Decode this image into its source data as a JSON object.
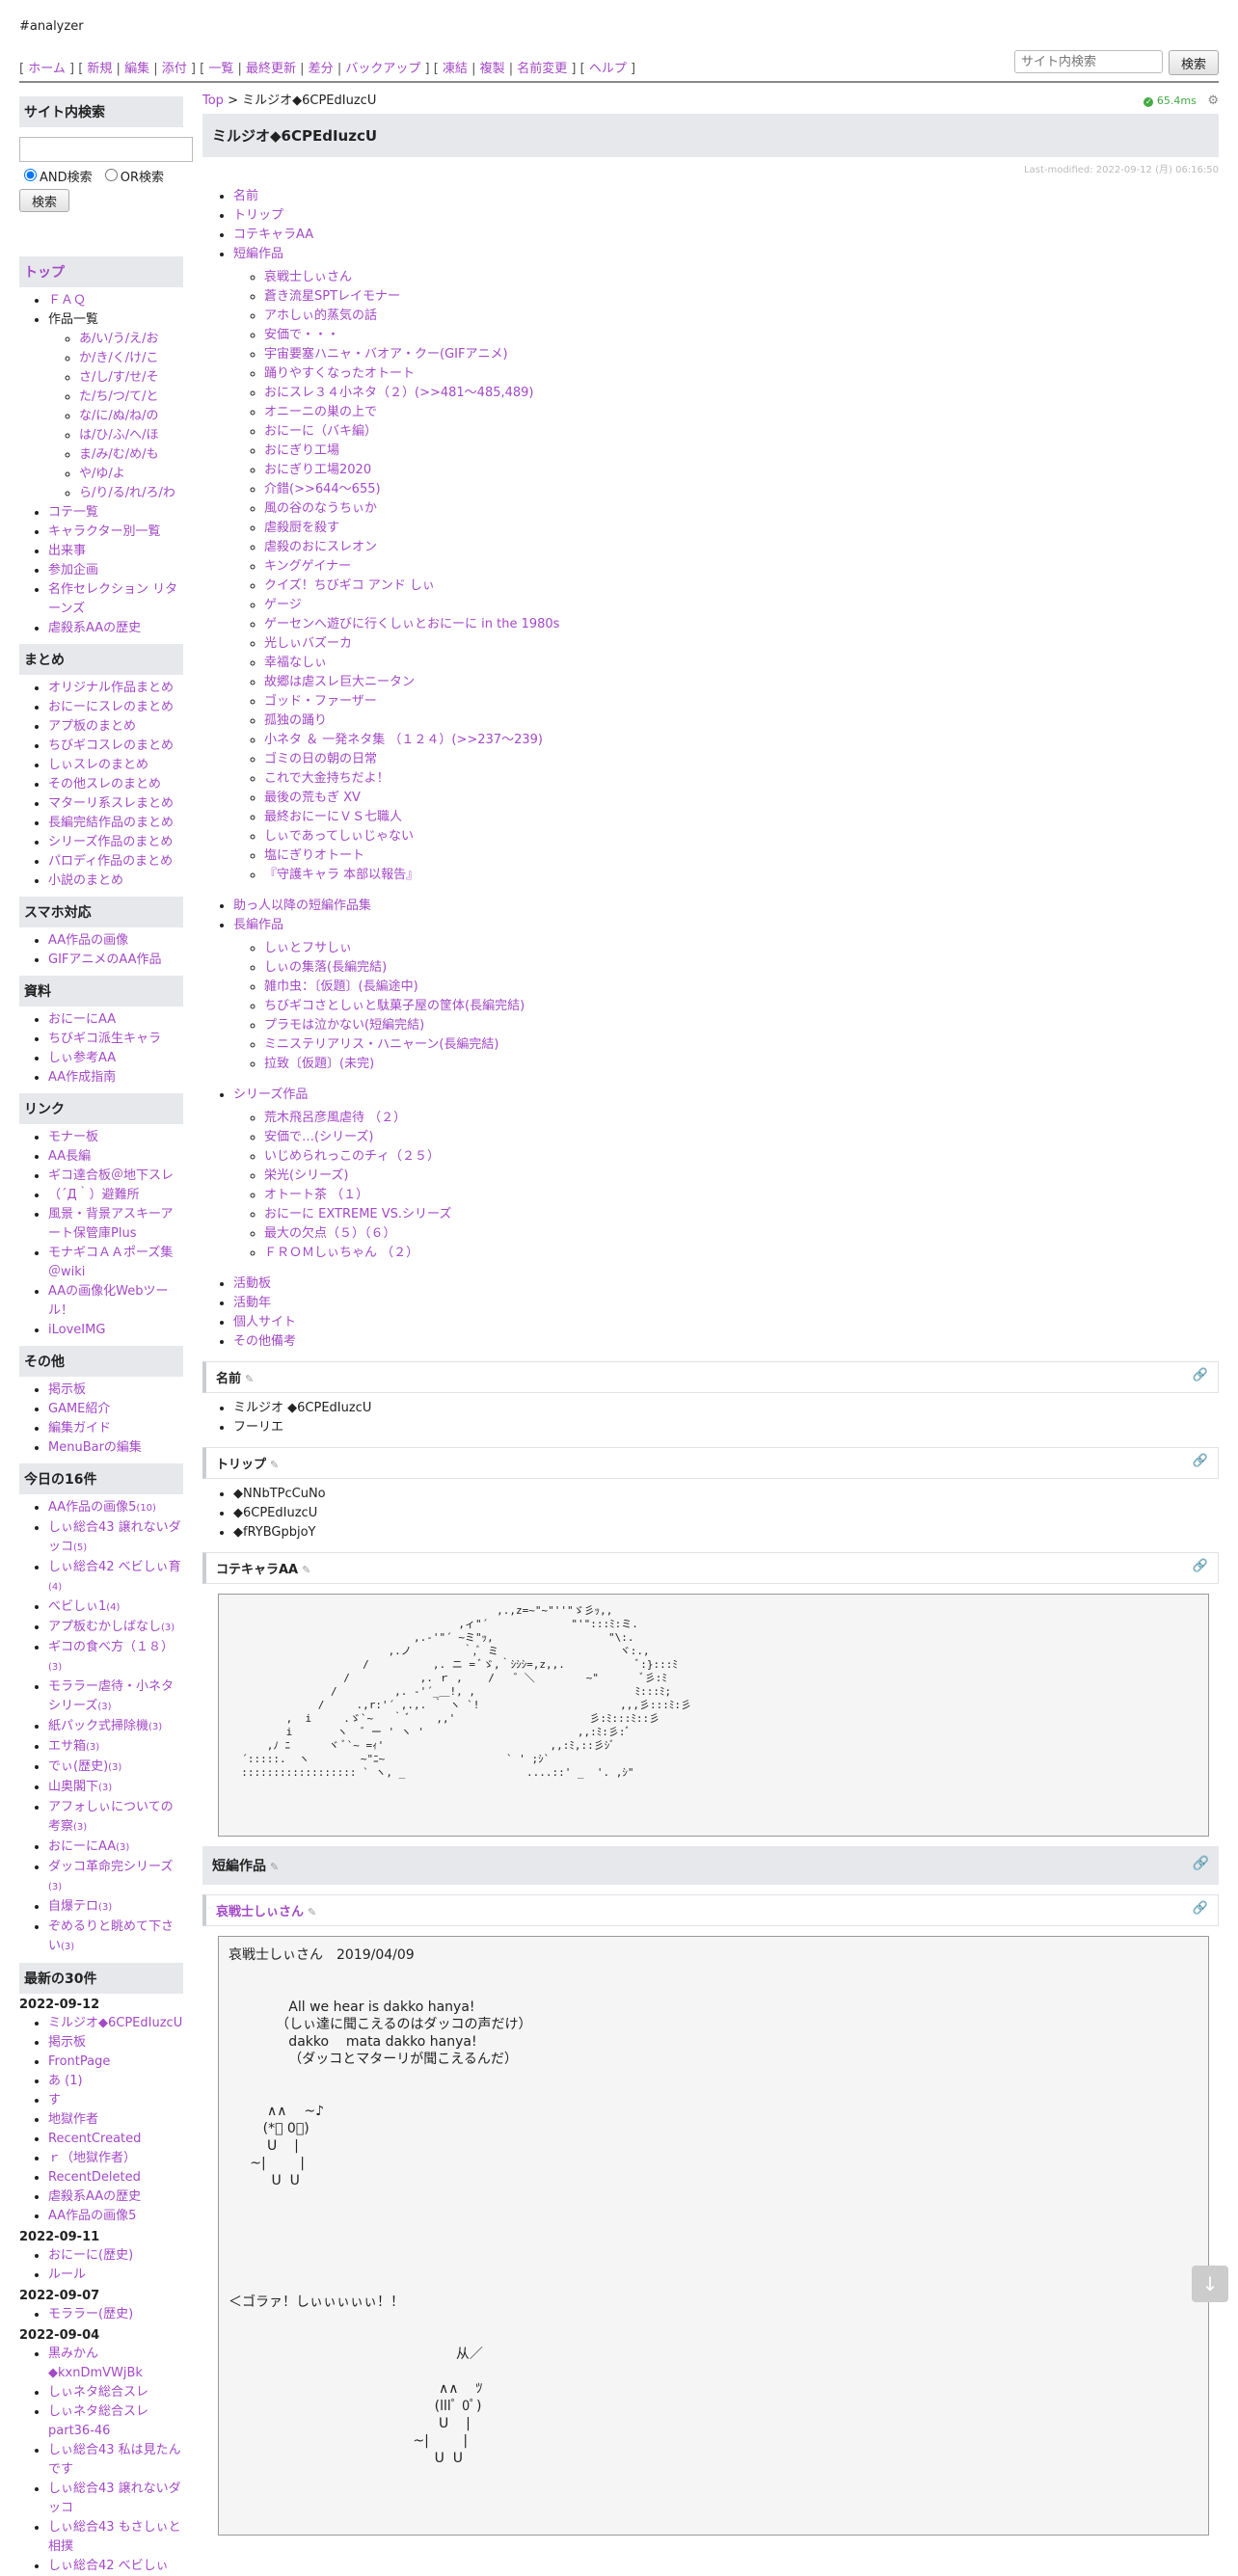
{
  "site_name": "#analyzer",
  "topnav": [
    [
      "ホーム"
    ],
    [
      "新規",
      "編集",
      "添付"
    ],
    [
      "一覧",
      "最終更新",
      "差分",
      "バックアップ"
    ],
    [
      "凍結",
      "複製",
      "名前変更"
    ],
    [
      "ヘルプ"
    ]
  ],
  "search": {
    "placeholder": "サイト内検索",
    "button": "検索"
  },
  "sidebar": {
    "search_title": "サイト内検索",
    "and_label": "AND検索",
    "or_label": "OR検索",
    "search_button": "検索",
    "top": "トップ",
    "top_items": {
      "faq": "ＦＡＱ",
      "works": "作品一覧",
      "works_sub": [
        "あ/い/う/え/お",
        "か/き/く/け/こ",
        "さ/し/す/せ/そ",
        "た/ち/つ/て/と",
        "な/に/ぬ/ね/の",
        "は/ひ/ふ/へ/ほ",
        "ま/み/む/め/も",
        "や/ゆ/よ",
        "ら/り/る/れ/ろ/わ"
      ],
      "rest": [
        "コテ一覧",
        "キャラクター別一覧",
        "出来事",
        "参加企画",
        "名作セレクション リターンズ",
        "虐殺系AAの歴史"
      ]
    },
    "matome_title": "まとめ",
    "matome": [
      "オリジナル作品まとめ",
      "おにーにスレのまとめ",
      "アプ板のまとめ",
      "ちびギコスレのまとめ",
      "しぃスレのまとめ",
      "その他スレのまとめ",
      "マターリ系スレまとめ",
      "長編完結作品のまとめ",
      "シリーズ作品のまとめ",
      "パロディ作品のまとめ",
      "小説のまとめ"
    ],
    "smartphone_title": "スマホ対応",
    "smartphone": [
      "AA作品の画像",
      "GIFアニメのAA作品"
    ],
    "material_title": "資料",
    "material": [
      "おにーにAA",
      "ちびギコ派生キャラ",
      "しぃ参考AA",
      "AA作成指南"
    ],
    "links_title": "リンク",
    "links": [
      "モナー板",
      "AA長編",
      "ギコ達合板＠地下スレ",
      "（´Д｀）避難所",
      "風景・背景アスキーアート保管庫Plus",
      "モナギコＡＡポーズ集＠wiki",
      "AAの画像化Webツール！",
      "iLoveIMG"
    ],
    "other_title": "その他",
    "other": [
      "掲示板",
      "GAME紹介",
      "編集ガイド",
      "MenuBarの編集"
    ],
    "today_title": "今日の16件",
    "today": [
      [
        "AA作品の画像5",
        "(10)"
      ],
      [
        "しぃ総合43 譲れないダッコ",
        "(5)"
      ],
      [
        "しぃ総合42 べビしぃ育",
        "(4)"
      ],
      [
        "べビしぃ1",
        "(4)"
      ],
      [
        "アプ板むかしばなし",
        "(3)"
      ],
      [
        "ギコの食べ方（１８）",
        "(3)"
      ],
      [
        "モララー虐待・小ネタシリーズ",
        "(3)"
      ],
      [
        "紙パック式掃除機",
        "(3)"
      ],
      [
        "エサ箱",
        "(3)"
      ],
      [
        "でぃ(歴史)",
        "(3)"
      ],
      [
        "山奥閣下",
        "(3)"
      ],
      [
        "アフォしぃについての考察",
        "(3)"
      ],
      [
        "おにーにAA",
        "(3)"
      ],
      [
        "ダッコ革命完シリーズ",
        "(3)"
      ],
      [
        "自爆テロ",
        "(3)"
      ],
      [
        "ぞめるりと眺めて下さい",
        "(3)"
      ]
    ],
    "recent_title": "最新の30件",
    "recent": [
      {
        "date": "2022-09-12",
        "items": [
          "ミルジオ◆6CPEdIuzcU",
          "掲示板",
          "FrontPage",
          "あ (1)",
          "す",
          "地獄作者",
          "RecentCreated",
          "ｒ（地獄作者）",
          "RecentDeleted",
          "虐殺系AAの歴史",
          "AA作品の画像5"
        ]
      },
      {
        "date": "2022-09-11",
        "items": [
          "おにーに(歴史)",
          "ルール"
        ]
      },
      {
        "date": "2022-09-07",
        "items": [
          "モララー(歴史)"
        ]
      },
      {
        "date": "2022-09-04",
        "items": [
          "黒みかん ◆kxnDmVWjBk",
          "しぃネタ総合スレ",
          "しぃネタ総合スレpart36-46",
          "しぃ総合43 私は見たんです",
          "しぃ総合43 譲れないダッコ",
          "しぃ総合43 もさしぃと相撲",
          "しぃ総合42 べビしぃ"
        ]
      }
    ]
  },
  "main": {
    "crumb_top": "Top",
    "crumb_sep": ">",
    "crumb_page": "ミルジオ◆6CPEdIuzcU",
    "timing": "65.4ms",
    "title": "ミルジオ◆6CPEdIuzcU",
    "last_modified": "Last-modified: 2022-09-12 (月) 06:16:50",
    "toc_top": [
      "名前",
      "トリップ",
      "コテキャラAA"
    ],
    "short_works_label": "短編作品",
    "short_works": [
      "哀戦士しぃさん",
      "蒼き流星SPTレイモナー",
      "アホしぃ的蒸気の話",
      "安価で・・・",
      "宇宙要塞ハニャ・バオア・クー(GIFアニメ)",
      "踊りやすくなったオトート",
      "おにスレ３４小ネタ（２）(>>481～485,489)",
      "オニーニの巣の上で",
      "おにーに（バキ編）",
      "おにぎり工場",
      "おにぎり工場2020",
      "介錯(>>644～655)",
      "風の谷のなうちぃか",
      "虐殺厨を殺す",
      "虐殺のおにスレオン",
      "キングゲイナー",
      "クイズ！ちびギコ アンド しぃ",
      "ゲージ",
      "ゲーセンへ遊びに行くしぃとおにーに in the 1980s",
      "光しぃバズーカ",
      "幸福なしぃ",
      "故郷は虐スレ巨大ニータン",
      "ゴッド・ファーザー",
      "孤独の踊り",
      "小ネタ ＆ 一発ネタ集 （１２４）(>>237～239)",
      "ゴミの日の朝の日常",
      "これで大金持ちだよ！",
      "最後の荒もぎ XV",
      "最終おにーにＶＳ七職人",
      "しぃであってしぃじゃない",
      "塩にぎりオトート",
      "『守護キャラ 本部以報告』"
    ],
    "assist_label": "助っ人以降の短編作品集",
    "long_works_label": "長編作品",
    "long_works": [
      "しぃとフサしぃ",
      "しぃの集落(長編完結)",
      "雑巾虫：〔仮題〕(長編途中)",
      "ちびギコさとしぃと駄菓子屋の筐体(長編完結)",
      "プラモは泣かない(短編完結)",
      "ミニステリアリス・ハニャーン(長編完結)",
      "拉致〔仮題〕(未完)"
    ],
    "series_label": "シリーズ作品",
    "series": [
      "荒木飛呂彦風虐待 （２）",
      "安価で…(シリーズ)",
      "いじめられっこのチィ（２５）",
      "栄光(シリーズ)",
      "オトート茶 （１）",
      "おにーに EXTREME VS.シリーズ",
      "最大の欠点（５）（６）",
      "ＦＲＯＭしぃちゃん （２）"
    ],
    "toc_bottom": [
      "活動板",
      "活動年",
      "個人サイト",
      "その他備考"
    ],
    "name_h": "名前",
    "name_list": [
      "ミルジオ ◆6CPEdIuzcU",
      "フーリエ"
    ],
    "trip_h": "トリップ",
    "trip_list": [
      "◆NNbTPcCuNo",
      "◆6CPEdIuzcU",
      "◆fRYBGpbjoY"
    ],
    "kote_h": "コテキャラAA",
    "kote_aa": "                                          ,.,z=~\"~\"''\"ゞ彡ｯ,,\n                                    ,ィ\"´             \"'\":::ﾐ:ミ.\n                             ,.-'\"´ ~ミ\"ｯ,                  \"\\:.\n                         ,.ノ        ｀,ﾞ ミ                   ヾ:.,\n                     /          ,. ニ = ﾞゞ,｀ｼｼｼ=,z,,.           ﾞ:}:::ﾐ\n                  /           ,. ｒ ,    /   ゛＼        ~\"       ﾞ彡:ﾐ\n                /         ,. ‐'´_＿!, ,                         ﾐ:::ﾐ;\n              /     .,r:'´ ,.,. ｀ ヽ `!                      ,,,彡:::ﾐ:彡\n         ,  i     .ゞ`~   ｀ ﾞ    ,,'                     彡:ﾐ:::ﾐ::彡\n         i       ヽ  ゛ー ' ヽ '                        ,,:ﾐ:彡:ﾞ\n      ,ﾉ ﾆ      ヾ ﾞ`~ =ｨ'                          ,,:ﾐ,::彡ｼﾞ\n  ´:::::.  ヽ        ~\"ﾆ~                   ` ' ;ｼ`\n  :::::::::::::::::: ` ヽ, _                   ....::' _  '. ,ｼ\"",
    "short_h": "短編作品",
    "work_h": "哀戦士しぃさん",
    "work_text": "哀戦士しぃさん　2019/04/09\n\n\n              All we hear is dakko hanya!\n           （しぃ達に聞こえるのはダッコの声だけ）\n              dakko    mata dakko hanya!\n              （ダッコとマターリが聞こえるんだ）\n\n\n         ∧∧    ~♪\n        (*ﾟ 0ﾟ)\n         U    |\n     ~|        |\n          U  U\n\n\n\n\n\n\n＜ゴラァ！しぃぃぃぃぃ！！\n\n\n                                                     从／\n\n                                                 ∧∧    ﾂ\n                                                (lllﾟ 0ﾟ)\n                                                 U    |\n                                           ~|        |\n                                                U  U"
  },
  "colors": {
    "link": "#a349c6",
    "header_bg": "#e6e8ec",
    "timing": "#44aa44"
  }
}
